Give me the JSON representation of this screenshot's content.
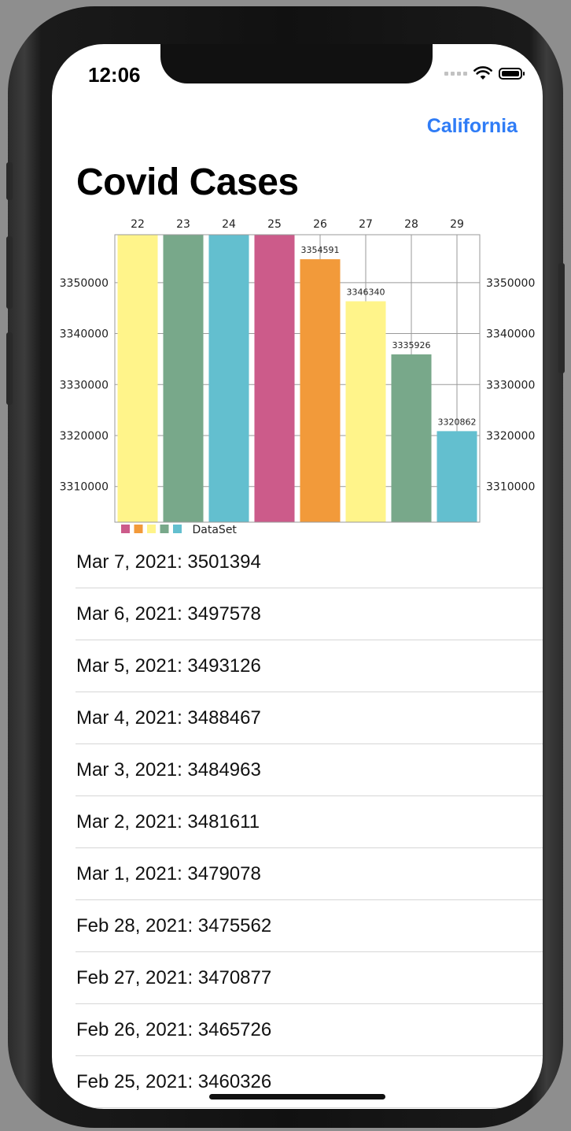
{
  "status_bar": {
    "time": "12:06"
  },
  "nav": {
    "state_button": "California"
  },
  "page_title": "Covid Cases",
  "chart_data": {
    "type": "bar",
    "categories": [
      "22",
      "23",
      "24",
      "25",
      "26",
      "27",
      "28",
      "29"
    ],
    "series": [
      {
        "name": "DataSet",
        "values": [
          3360000,
          3360000,
          3360000,
          3360000,
          3354591,
          3346340,
          3335926,
          3320862
        ]
      }
    ],
    "data_labels": [
      "",
      "",
      "",
      "",
      "3354591",
      "3346340",
      "3335926",
      "3320862"
    ],
    "bar_colors": [
      "#fff48a",
      "#78a88a",
      "#63bfcf",
      "#cc5b8a",
      "#f29a3a",
      "#fff48a",
      "#78a88a",
      "#63bfcf"
    ],
    "legend_swatches": [
      "#cc5b8a",
      "#f29a3a",
      "#fff48a",
      "#78a88a",
      "#63bfcf"
    ],
    "ylim": [
      3303000,
      3359400
    ],
    "y_ticks": [
      "3310000",
      "3320000",
      "3330000",
      "3340000",
      "3350000"
    ],
    "legend_label": "DataSet",
    "legend_position": "bottom-left",
    "grid": true
  },
  "list": {
    "rows": [
      "Mar 7, 2021: 3501394",
      "Mar 6, 2021: 3497578",
      "Mar 5, 2021: 3493126",
      "Mar 4, 2021: 3488467",
      "Mar 3, 2021: 3484963",
      "Mar 2, 2021: 3481611",
      "Mar 1, 2021: 3479078",
      "Feb 28, 2021: 3475562",
      "Feb 27, 2021: 3470877",
      "Feb 26, 2021: 3465726",
      "Feb 25, 2021: 3460326"
    ]
  }
}
